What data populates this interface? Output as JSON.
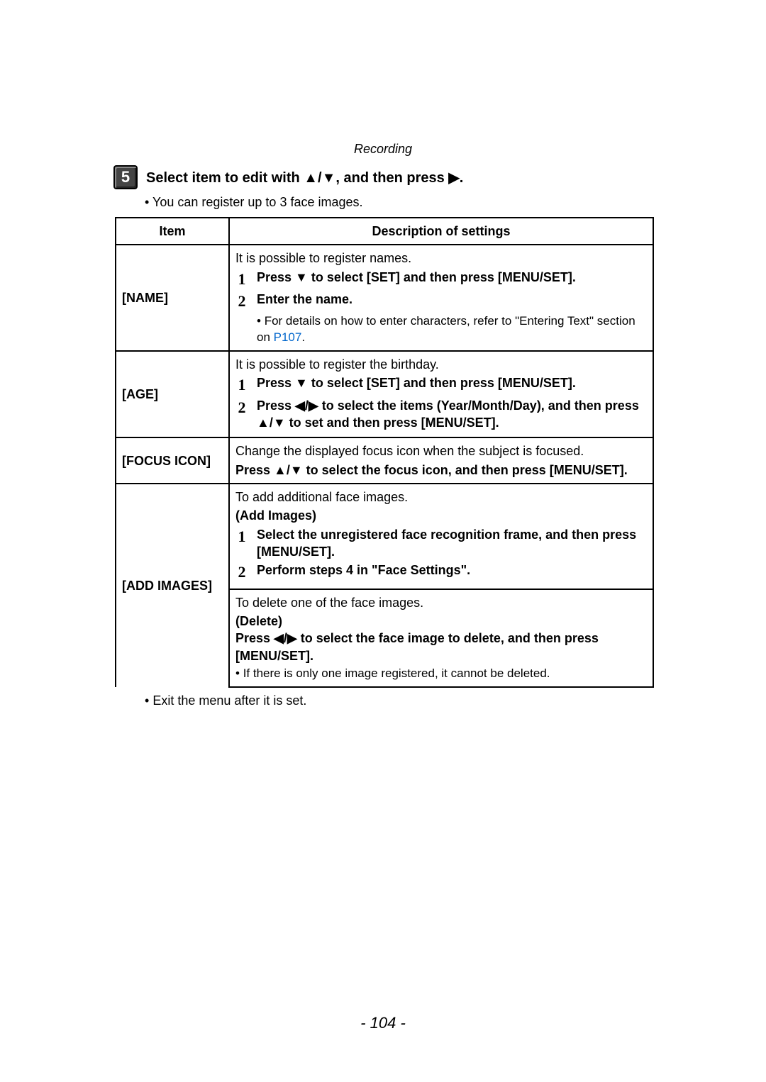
{
  "section_header": "Recording",
  "step_number": "5",
  "step_title": "Select item to edit with ▲/▼, and then press ▶.",
  "intro_bullet": "You can register up to 3 face images.",
  "table": {
    "header_item": "Item",
    "header_desc": "Description of settings",
    "rows": {
      "name": {
        "label": "[NAME]",
        "intro": "It is possible to register names.",
        "steps": [
          {
            "num": "1",
            "text": "Press ▼ to select [SET] and then press [MENU/SET]."
          },
          {
            "num": "2",
            "text": "Enter the name."
          }
        ],
        "sub_bullet_prefix": "For details on how to enter characters, refer to \"Entering Text\" section on ",
        "link_text": "P107",
        "sub_bullet_suffix": "."
      },
      "age": {
        "label": "[AGE]",
        "intro": "It is possible to register the birthday.",
        "steps": [
          {
            "num": "1",
            "text": "Press ▼ to select [SET] and then press [MENU/SET]."
          },
          {
            "num": "2",
            "text": "Press ◀/▶ to select the items (Year/Month/Day), and then press ▲/▼ to set and then press [MENU/SET]."
          }
        ]
      },
      "focus_icon": {
        "label": "[FOCUS ICON]",
        "intro": "Change the displayed focus icon when the subject is focused.",
        "bold_text": "Press ▲/▼ to select the focus icon, and then press [MENU/SET]."
      },
      "add_images": {
        "label": "[ADD IMAGES]",
        "block1": {
          "intro": "To add additional face images.",
          "subhead": "(Add Images)",
          "steps": [
            {
              "num": "1",
              "text": "Select the unregistered face recognition frame, and then press [MENU/SET]."
            },
            {
              "num": "2",
              "text": "Perform steps 4 in \"Face Settings\"."
            }
          ]
        },
        "block2": {
          "intro": "To delete one of the face images.",
          "subhead": "(Delete)",
          "bold_text": "Press ◀/▶ to select the face image to delete, and then press [MENU/SET].",
          "bullet": "If there is only one image registered, it cannot be deleted."
        }
      }
    }
  },
  "exit_bullet": "Exit the menu after it is set.",
  "page_number": "- 104 -"
}
